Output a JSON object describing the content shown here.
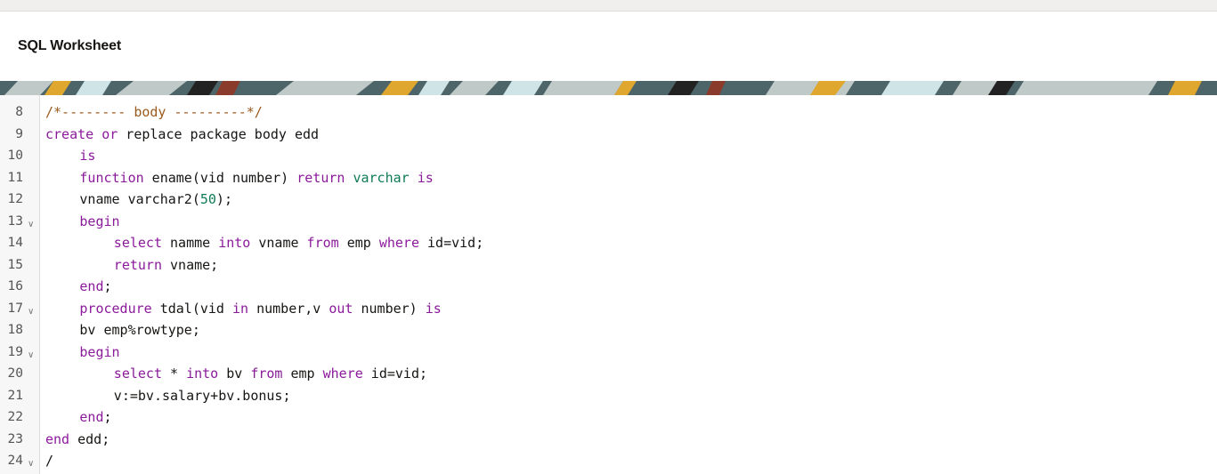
{
  "header": {
    "title": "SQL Worksheet"
  },
  "colors": {
    "keyword": "#8b1a9b",
    "comment": "#9a5a1e",
    "number": "#0e7a57",
    "type": "#0e7a57",
    "text": "#161513"
  },
  "editor": {
    "lines": [
      {
        "num": "8",
        "fold": false,
        "indent": 0,
        "tokens": [
          {
            "t": "/*-------- body ---------*/",
            "c": "cm"
          }
        ]
      },
      {
        "num": "9",
        "fold": false,
        "indent": 0,
        "tokens": [
          {
            "t": "create",
            "c": "kw"
          },
          {
            "t": " ",
            "c": "tx"
          },
          {
            "t": "or",
            "c": "kw"
          },
          {
            "t": " replace package body edd",
            "c": "tx"
          }
        ]
      },
      {
        "num": "10",
        "fold": false,
        "indent": 1,
        "tokens": [
          {
            "t": "is",
            "c": "kw"
          }
        ]
      },
      {
        "num": "11",
        "fold": false,
        "indent": 1,
        "tokens": [
          {
            "t": "function",
            "c": "kw"
          },
          {
            "t": " ename(vid number) ",
            "c": "tx"
          },
          {
            "t": "return",
            "c": "kw"
          },
          {
            "t": " ",
            "c": "tx"
          },
          {
            "t": "varchar",
            "c": "ty"
          },
          {
            "t": " ",
            "c": "tx"
          },
          {
            "t": "is",
            "c": "kw"
          }
        ]
      },
      {
        "num": "12",
        "fold": false,
        "indent": 1,
        "tokens": [
          {
            "t": "vname varchar2(",
            "c": "tx"
          },
          {
            "t": "50",
            "c": "num"
          },
          {
            "t": ");",
            "c": "tx"
          }
        ]
      },
      {
        "num": "13",
        "fold": true,
        "indent": 1,
        "tokens": [
          {
            "t": "begin",
            "c": "kw"
          }
        ]
      },
      {
        "num": "14",
        "fold": false,
        "indent": 2,
        "tokens": [
          {
            "t": "select",
            "c": "kw"
          },
          {
            "t": " namme ",
            "c": "tx"
          },
          {
            "t": "into",
            "c": "kw"
          },
          {
            "t": " vname ",
            "c": "tx"
          },
          {
            "t": "from",
            "c": "kw"
          },
          {
            "t": " emp ",
            "c": "tx"
          },
          {
            "t": "where",
            "c": "kw"
          },
          {
            "t": " id=vid;",
            "c": "tx"
          }
        ]
      },
      {
        "num": "15",
        "fold": false,
        "indent": 2,
        "tokens": [
          {
            "t": "return",
            "c": "kw"
          },
          {
            "t": " vname;",
            "c": "tx"
          }
        ]
      },
      {
        "num": "16",
        "fold": false,
        "indent": 1,
        "tokens": [
          {
            "t": "end",
            "c": "kw"
          },
          {
            "t": ";",
            "c": "tx"
          }
        ]
      },
      {
        "num": "17",
        "fold": true,
        "indent": 1,
        "tokens": [
          {
            "t": "procedure",
            "c": "kw"
          },
          {
            "t": " tdal(vid ",
            "c": "tx"
          },
          {
            "t": "in",
            "c": "kw"
          },
          {
            "t": " number,v ",
            "c": "tx"
          },
          {
            "t": "out",
            "c": "kw"
          },
          {
            "t": " number) ",
            "c": "tx"
          },
          {
            "t": "is",
            "c": "kw"
          }
        ]
      },
      {
        "num": "18",
        "fold": false,
        "indent": 1,
        "tokens": [
          {
            "t": "bv emp%rowtype;",
            "c": "tx"
          }
        ]
      },
      {
        "num": "19",
        "fold": true,
        "indent": 1,
        "tokens": [
          {
            "t": "begin",
            "c": "kw"
          }
        ]
      },
      {
        "num": "20",
        "fold": false,
        "indent": 2,
        "tokens": [
          {
            "t": "select",
            "c": "kw"
          },
          {
            "t": " * ",
            "c": "tx"
          },
          {
            "t": "into",
            "c": "kw"
          },
          {
            "t": " bv ",
            "c": "tx"
          },
          {
            "t": "from",
            "c": "kw"
          },
          {
            "t": " emp ",
            "c": "tx"
          },
          {
            "t": "where",
            "c": "kw"
          },
          {
            "t": " id=vid;",
            "c": "tx"
          }
        ]
      },
      {
        "num": "21",
        "fold": false,
        "indent": 2,
        "tokens": [
          {
            "t": "v:=bv.salary+bv.bonus;",
            "c": "tx"
          }
        ]
      },
      {
        "num": "22",
        "fold": false,
        "indent": 1,
        "tokens": [
          {
            "t": "end",
            "c": "kw"
          },
          {
            "t": ";",
            "c": "tx"
          }
        ]
      },
      {
        "num": "23",
        "fold": false,
        "indent": 0,
        "tokens": [
          {
            "t": "end",
            "c": "kw"
          },
          {
            "t": " edd;",
            "c": "tx"
          }
        ]
      },
      {
        "num": "24",
        "fold": true,
        "indent": 0,
        "tokens": [
          {
            "t": "/",
            "c": "tx"
          }
        ]
      }
    ]
  }
}
